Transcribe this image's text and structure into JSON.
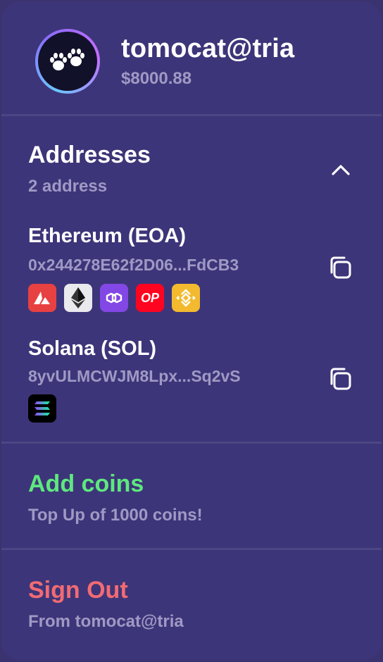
{
  "profile": {
    "username": "tomocat@tria",
    "balance": "$8000.88",
    "avatar_icon": "paw-icon"
  },
  "addresses": {
    "title": "Addresses",
    "subtitle": "2 address",
    "expanded": true,
    "items": [
      {
        "name": "Ethereum (EOA)",
        "address": "0x244278E62f2D06...FdCB3",
        "chains": [
          "avalanche-icon",
          "ethereum-icon",
          "polygon-icon",
          "optimism-icon",
          "bnb-icon"
        ]
      },
      {
        "name": "Solana (SOL)",
        "address": "8yvULMCWJM8Lpx...Sq2vS",
        "chains": [
          "solana-icon"
        ]
      }
    ]
  },
  "add_coins": {
    "title": "Add coins",
    "subtitle": "Top Up of 1000 coins!",
    "color": "#5ee87f"
  },
  "sign_out": {
    "title": "Sign Out",
    "subtitle": "From tomocat@tria",
    "color": "#f26b73"
  },
  "chain_labels": {
    "optimism": "OP"
  }
}
